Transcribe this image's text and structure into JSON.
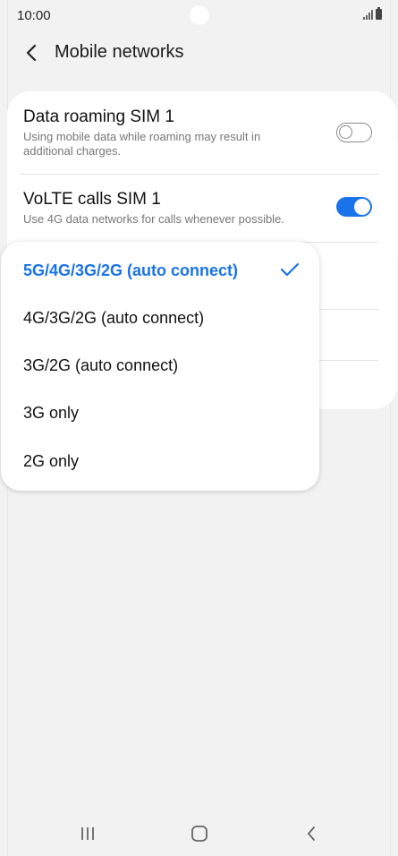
{
  "status_bar": {
    "time": "10:00"
  },
  "header": {
    "title": "Mobile networks"
  },
  "settings": [
    {
      "title": "Data roaming SIM 1",
      "subtitle": "Using mobile data while roaming may result in additional charges.",
      "toggle": "off"
    },
    {
      "title": "VoLTE calls SIM 1",
      "subtitle": "Use 4G data networks for calls whenever possible.",
      "toggle": "on"
    }
  ],
  "network_mode_popup": {
    "selected_index": 0,
    "options": [
      {
        "label": "5G/4G/3G/2G (auto connect)"
      },
      {
        "label": "4G/3G/2G (auto connect)"
      },
      {
        "label": "3G/2G (auto connect)"
      },
      {
        "label": "3G only"
      },
      {
        "label": "2G only"
      }
    ]
  },
  "colors": {
    "accent": "#1a73e8",
    "background": "#f2f2f2",
    "card": "#ffffff"
  },
  "icons": {
    "back": "chevron-left-icon",
    "check": "check-icon",
    "nav_recents": "recents-icon",
    "nav_home": "home-icon",
    "nav_back": "back-icon"
  }
}
